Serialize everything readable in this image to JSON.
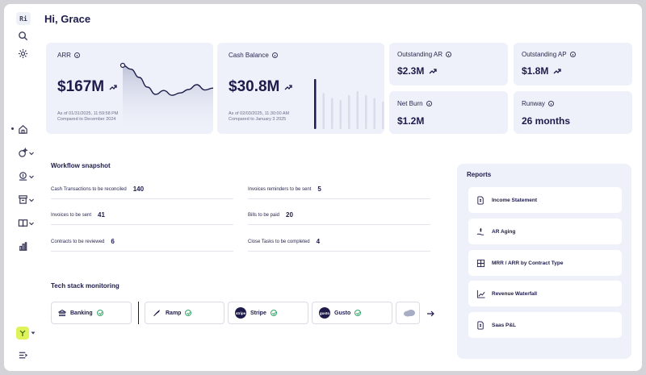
{
  "sidebar": {
    "badge": "Ri",
    "items": [
      {
        "name": "home",
        "icon": "home-icon"
      },
      {
        "name": "ai",
        "icon": "sparkle-icon"
      },
      {
        "name": "revenue",
        "icon": "coins-icon"
      },
      {
        "name": "payments",
        "icon": "hand-coin-icon"
      },
      {
        "name": "tasks",
        "icon": "inbox-icon"
      },
      {
        "name": "library",
        "icon": "book-icon"
      },
      {
        "name": "reports",
        "icon": "bar-chart-icon"
      }
    ]
  },
  "header": {
    "greeting": "Hi, Grace"
  },
  "cards": {
    "arr": {
      "label": "ARR",
      "value": "$167M",
      "asof": "As of 01/31/2025, 11:59:58 PM",
      "compare": "Compared to December 2024"
    },
    "cash": {
      "label": "Cash Balance",
      "value": "$30.8M",
      "asof": "As of 02/03/2025, 11:30:00 AM",
      "compare": "Compared to January 3 2025"
    },
    "outstanding_ar": {
      "label": "Outstanding AR",
      "value": "$2.3M"
    },
    "outstanding_ap": {
      "label": "Outstanding AP",
      "value": "$1.8M"
    },
    "net_burn": {
      "label": "Net Burn",
      "value": "$1.2M"
    },
    "runway": {
      "label": "Runway",
      "value": "26 months"
    }
  },
  "chart_data": [
    {
      "type": "line",
      "title": "",
      "xlabel": "",
      "ylabel": "",
      "x": [
        1,
        2,
        3,
        4,
        5,
        6,
        7,
        8,
        9,
        10,
        11,
        12
      ],
      "values": [
        100,
        92,
        75,
        55,
        40,
        48,
        38,
        43,
        50,
        60,
        49,
        53
      ]
    },
    {
      "type": "bar",
      "title": "",
      "xlabel": "",
      "ylabel": "",
      "categories": [
        "1",
        "2",
        "3",
        "4",
        "5",
        "6",
        "7",
        "8",
        "9"
      ],
      "values": [
        100,
        72,
        62,
        58,
        68,
        76,
        68,
        62,
        55
      ]
    }
  ],
  "workflow": {
    "title": "Workflow snapshot",
    "items": [
      {
        "label": "Cash Transactions to be reconciled",
        "count": "140"
      },
      {
        "label": "Invoices reminders to be sent",
        "count": "5"
      },
      {
        "label": "Invoices to be sent",
        "count": "41"
      },
      {
        "label": "Bills to be paid",
        "count": "20"
      },
      {
        "label": "Contracts to be reviewed",
        "count": "6"
      },
      {
        "label": "Close Tasks to be completed",
        "count": "4"
      }
    ]
  },
  "tech": {
    "title": "Tech stack monitoring",
    "items": [
      {
        "name": "Banking",
        "logo": ""
      },
      {
        "name": "Ramp",
        "logo": ""
      },
      {
        "name": "Stripe",
        "logo": "stripe"
      },
      {
        "name": "Gusto",
        "logo": "gusto"
      }
    ]
  },
  "reports": {
    "title": "Reports",
    "items": [
      {
        "name": "Income Statement"
      },
      {
        "name": "AR Aging"
      },
      {
        "name": "MRR / ARR by Contract Type"
      },
      {
        "name": "Revenue Waterfall"
      },
      {
        "name": "Saas P&L"
      }
    ]
  },
  "colors": {
    "accent": "#1e1b4b",
    "card_bg": "#eef1fa",
    "ok": "#35a56a",
    "avatar": "#dff25a"
  }
}
